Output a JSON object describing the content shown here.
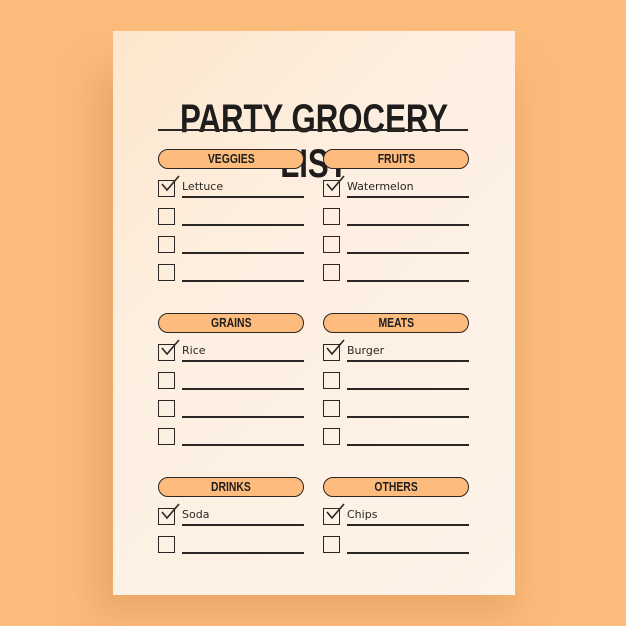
{
  "title": "PARTY GROCERY LIST",
  "colors": {
    "background": "#fdbb7b",
    "paper": "#fdf0e2",
    "pill": "#fdbb7d",
    "ink": "#2a2724"
  },
  "sections": [
    {
      "label": "VEGGIES",
      "items": [
        {
          "text": "Lettuce",
          "checked": true
        },
        {
          "text": "",
          "checked": false
        },
        {
          "text": "",
          "checked": false
        },
        {
          "text": "",
          "checked": false
        }
      ]
    },
    {
      "label": "FRUITS",
      "items": [
        {
          "text": "Watermelon",
          "checked": true
        },
        {
          "text": "",
          "checked": false
        },
        {
          "text": "",
          "checked": false
        },
        {
          "text": "",
          "checked": false
        }
      ]
    },
    {
      "label": "GRAINS",
      "items": [
        {
          "text": "Rice",
          "checked": true
        },
        {
          "text": "",
          "checked": false
        },
        {
          "text": "",
          "checked": false
        },
        {
          "text": "",
          "checked": false
        }
      ]
    },
    {
      "label": "MEATS",
      "items": [
        {
          "text": "Burger",
          "checked": true
        },
        {
          "text": "",
          "checked": false
        },
        {
          "text": "",
          "checked": false
        },
        {
          "text": "",
          "checked": false
        }
      ]
    },
    {
      "label": "DRINKS",
      "items": [
        {
          "text": "Soda",
          "checked": true
        },
        {
          "text": "",
          "checked": false
        }
      ]
    },
    {
      "label": "OTHERS",
      "items": [
        {
          "text": "Chips",
          "checked": true
        },
        {
          "text": "",
          "checked": false
        }
      ]
    }
  ]
}
